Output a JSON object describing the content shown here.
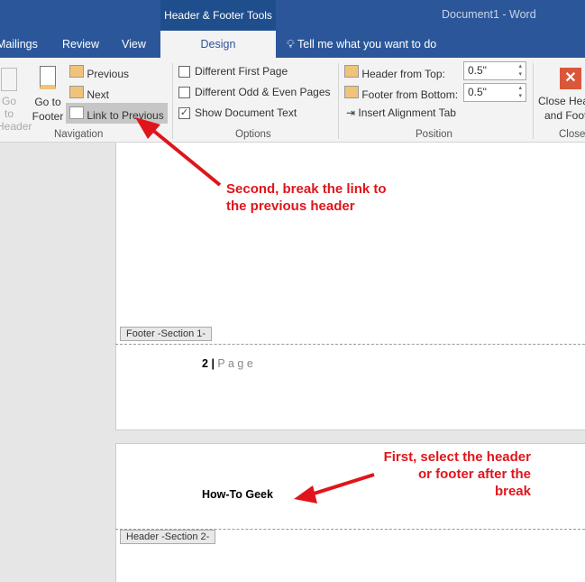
{
  "titlebar": {
    "contextual": "Header & Footer Tools",
    "document": "Document1  -  Word"
  },
  "tabs": [
    "Mailings",
    "Review",
    "View",
    "Design"
  ],
  "tell_me": "Tell me what you want to do",
  "navigation": {
    "go_to_header": [
      "Go to",
      "Header"
    ],
    "go_to_footer": [
      "Go to",
      "Footer"
    ],
    "previous": "Previous",
    "next": "Next",
    "link_to_previous": "Link to Previous",
    "label": "Navigation"
  },
  "options": {
    "different_first_page": "Different First Page",
    "different_odd_even": "Different Odd & Even Pages",
    "show_document_text": "Show Document Text",
    "label": "Options",
    "checked": {
      "different_first_page": false,
      "different_odd_even": false,
      "show_document_text": true
    }
  },
  "position": {
    "header_from_top": "Header from Top:",
    "header_value": "0.5\"",
    "footer_from_bottom": "Footer from Bottom:",
    "footer_value": "0.5\"",
    "insert_alignment_tab": "Insert Alignment Tab",
    "label": "Position"
  },
  "close": {
    "button": [
      "Close Hea",
      "and Foot"
    ],
    "label": "Close"
  },
  "document": {
    "footer_tag": "Footer -Section 1-",
    "page_number": "2",
    "page_word": "P a g e",
    "header_text": "How-To Geek",
    "header_tag": "Header -Section 2-"
  },
  "annotations": {
    "second": [
      "Second, break the link to",
      "the previous header"
    ],
    "first": [
      "First, select the header",
      "or footer after the",
      "break"
    ]
  },
  "colors": {
    "brand": "#2b579a",
    "annotation": "#e0151b"
  }
}
